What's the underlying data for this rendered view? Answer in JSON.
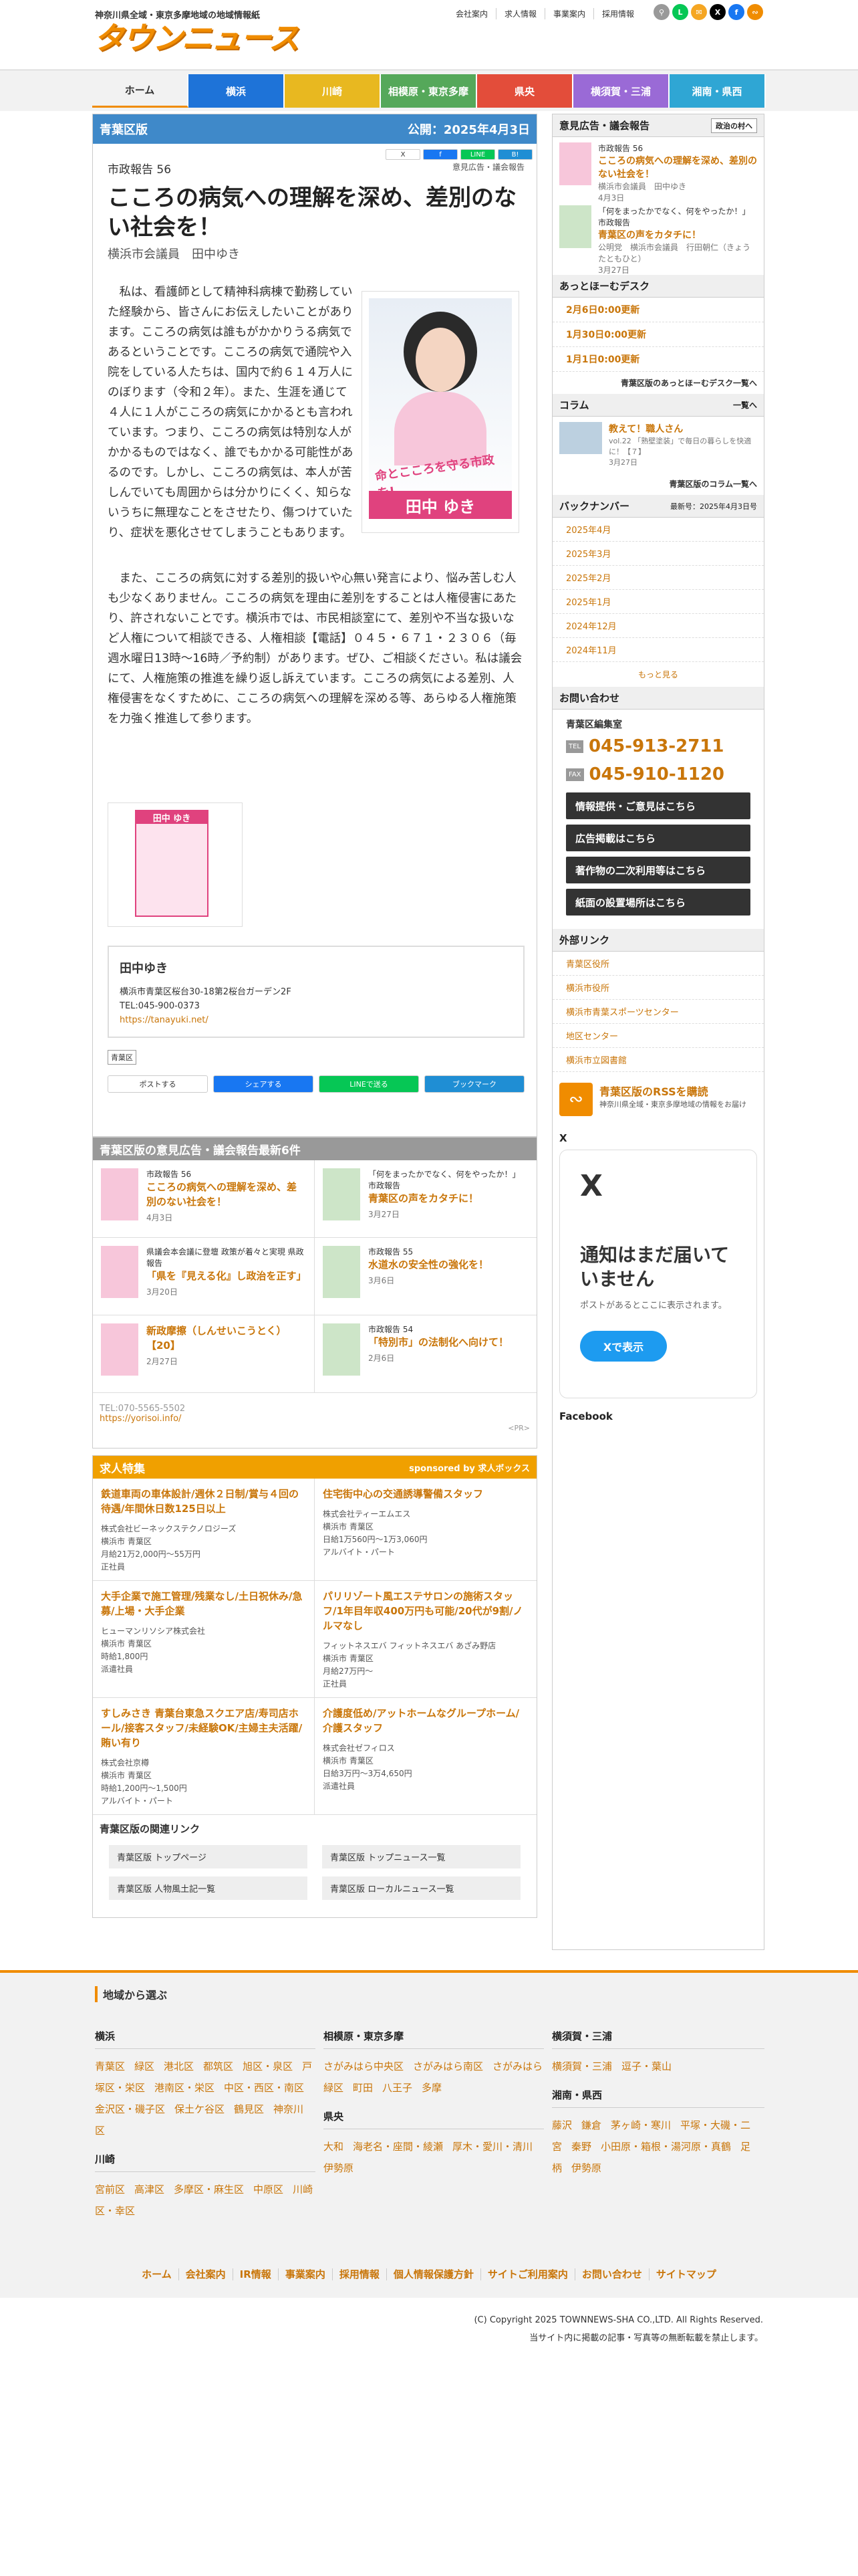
{
  "header": {
    "tagline": "神奈川県全域・東京多摩地域の地域情報紙",
    "logo": "タウンニュース",
    "links": [
      "会社案内",
      "求人情報",
      "事業案内",
      "採用情報"
    ]
  },
  "nav": [
    {
      "label": "ホーム",
      "color": "#f2f2f2",
      "text": "#333"
    },
    {
      "label": "横浜",
      "color": "#1e73d8",
      "text": "#fff"
    },
    {
      "label": "川崎",
      "color": "#e8b820",
      "text": "#fff"
    },
    {
      "label": "相模原・東京多摩",
      "color": "#55a85a",
      "text": "#fff"
    },
    {
      "label": "県央",
      "color": "#e34d3a",
      "text": "#fff"
    },
    {
      "label": "横須賀・三浦",
      "color": "#9a6ad6",
      "text": "#fff"
    },
    {
      "label": "湘南・県西",
      "color": "#2fa6d4",
      "text": "#fff"
    }
  ],
  "main": {
    "edition": "青葉区版",
    "published": "公開：2025年4月3日",
    "share_mini": [
      "X",
      "f",
      "LINE",
      "B!"
    ],
    "category": "市政報告 56",
    "category2": "意見広告・議会報告",
    "title": "こころの病気への理解を深め、差別のない社会を！",
    "byline": "横浜市会議員　田中ゆき",
    "photo_caption1": "命とこころを守る",
    "photo_caption2": "市政を!",
    "photo_name": "田中 ゆき",
    "p1": "私は、看護師として精神科病棟で勤務していた経験から、皆さんにお伝えしたいことがあります。こころの病気は誰もがかかりうる病気であるということです。こころの病気で通院や入院をしている人たちは、国内で約６１４万人にのぼります（令和２年）。また、生涯を通じて４人に１人がこころの病気にかかるとも言われています。つまり、こころの病気は特別な人がかかるものではなく、誰でもかかる可能性があるのです。しかし、こころの病気は、本人が苦しんでいても周囲からは分かりにくく、知らないうちに無理なことをさせたり、傷つけていたり、症状を悪化させてしまうこともあります。",
    "p2": "また、こころの病気に対する差別的扱いや心無い発言により、悩み苦しむ人も少なくありません。こころの病気を理由に差別をすることは人権侵害にあたり、許されないことです。横浜市では、市民相談室にて、差別や不当な扱いなど人権について相談できる、人権相談【電話】０４５・６７１・２３０６（毎週水曜日13時〜16時／予約制）があります。ぜひ、ご相談ください。私は議会にて、人権施策の推進を繰り返し訴えています。こころの病気による差別、人権侵害をなくすために、こころの病気への理解を深める等、あらゆる人権施策を力強く推進して参ります。",
    "ad_name": "田中 ゆき",
    "contact": {
      "name": "田中ゆき",
      "addr": "横浜市青葉区桜台30-18第2桜台ガーデン2F",
      "tel": "TEL:045-900-0373",
      "url": "https://tanayuki.net/"
    },
    "tag": "青葉区",
    "share": [
      {
        "label": "ポストする",
        "bg": "#fff",
        "c": "#333"
      },
      {
        "label": "シェアする",
        "bg": "#1877f2",
        "c": "#fff"
      },
      {
        "label": "LINEで送る",
        "bg": "#06c755",
        "c": "#fff"
      },
      {
        "label": "ブックマーク",
        "bg": "#1f8ed4",
        "c": "#fff"
      }
    ],
    "latest_head": "青葉区版の意見広告・議会報告最新6件",
    "latest": [
      {
        "cat": "市政報告 56",
        "title": "こころの病気への理解を深め、差別のない社会を！",
        "date": "4月3日"
      },
      {
        "cat": "「何をまったかでなく、何をやったか！」 市政報告",
        "title": "青葉区の声をカタチに！",
        "date": "3月27日"
      },
      {
        "cat": "県議会本会議に登壇 政策が着々と実現 県政報告",
        "title": "「県を『見える化』し政治を正す」",
        "date": "3月20日"
      },
      {
        "cat": "市政報告 55",
        "title": "水道水の安全性の強化を！",
        "date": "3月6日"
      },
      {
        "cat": "",
        "title": "新政摩擦（しんせいこうとく）【20】",
        "date": "2月27日"
      },
      {
        "cat": "市政報告 54",
        "title": "「特別市」の法制化へ向けて！",
        "date": "2月6日"
      }
    ],
    "footer_tel": "TEL:070-5565-5502",
    "footer_url": "https://yorisoi.info/",
    "pr": "<PR>",
    "jobs_head": "求人特集",
    "jobs_sponsor": "sponsored by 求人ボックス",
    "jobs": [
      {
        "t": "鉄道車両の車体設計/週休２日制/賞与４回の待遇/年間休日数125日以上",
        "co": "株式会社ビーネックステクノロジーズ",
        "loc": "横浜市 青葉区",
        "pay": "月給21万2,000円〜55万円",
        "type": "正社員"
      },
      {
        "t": "住宅街中心の交通誘導警備スタッフ",
        "co": "株式会社ティーエムエス",
        "loc": "横浜市 青葉区",
        "pay": "日給1万560円〜1万3,060円",
        "type": "アルバイト・パート"
      },
      {
        "t": "大手企業で施工管理/残業なし/土日祝休み/急募/上場・大手企業",
        "co": "ヒューマンリソシア株式会社",
        "loc": "横浜市 青葉区",
        "pay": "時給1,800円",
        "type": "派遣社員"
      },
      {
        "t": "パリリゾート風エステサロンの施術スタッフ/1年目年収400万円も可能/20代が9割/ノルマなし",
        "co": "フィットネスエバ フィットネスエバ あざみ野店",
        "loc": "横浜市 青葉区",
        "pay": "月給27万円〜",
        "type": "正社員"
      },
      {
        "t": "すしみさき 青葉台東急スクエア店/寿司店ホール/接客スタッフ/未経験OK/主婦主夫活躍/賄い有り",
        "co": "株式会社京樽",
        "loc": "横浜市 青葉区",
        "pay": "時給1,200円〜1,500円",
        "type": "アルバイト・パート"
      },
      {
        "t": "介護度低め/アットホームなグループホーム/介護スタッフ",
        "co": "株式会社ゼフィロス",
        "loc": "横浜市 青葉区",
        "pay": "日給3万円〜3万4,650円",
        "type": "派遣社員"
      }
    ],
    "related_head": "青葉区版の関連リンク",
    "related": [
      "青葉区版 トップページ",
      "青葉区版 トップニュース一覧",
      "青葉区版 人物風土記一覧",
      "青葉区版 ローカルニュース一覧"
    ]
  },
  "side": {
    "ads_head": "意見広告・議会報告",
    "ads_btn": "政治の村へ",
    "ads": [
      {
        "cat": "市政報告 56",
        "title": "こころの病気への理解を深め、差別のない社会を！",
        "sub": "横浜市会議員　田中ゆき",
        "date": "4月3日"
      },
      {
        "cat": "「何をまったかでなく、何をやったか！」 市政報告",
        "title": "青葉区の声をカタチに！",
        "sub": "公明党　横浜市会議員　行田朝仁（きょうたともひと）",
        "date": "3月27日"
      }
    ],
    "desk_head": "あっとほーむデスク",
    "desk": [
      "2月6日0:00更新",
      "1月30日0:00更新",
      "1月1日0:00更新"
    ],
    "desk_more": "青葉区版のあっとほーむデスク一覧へ",
    "col_head": "コラム",
    "col_more": "一覧へ",
    "col": {
      "title": "教えて！職人さん",
      "sub": "vol.22 「熟壁塗装」で毎日の暮らしを快適に！【７】",
      "date": "3月27日"
    },
    "col_link": "青葉区版のコラム一覧へ",
    "bn_head": "バックナンバー",
    "bn_upd": "最新号：2025年4月3日号",
    "bn": [
      "2025年4月",
      "2025年3月",
      "2025年2月",
      "2025年1月",
      "2024年12月",
      "2024年11月"
    ],
    "bn_more": "もっと見る",
    "contact_head": "お問い合わせ",
    "contact_sub": "青葉区編集室",
    "tel": "045-913-2711",
    "fax": "045-910-1120",
    "btns": [
      "情報提供・ご意見はこちら",
      "広告掲載はこちら",
      "著作物の二次利用等はこちら",
      "紙面の設置場所はこちら"
    ],
    "ext_head": "外部リンク",
    "ext": [
      "青葉区役所",
      "横浜市役所",
      "横浜市青葉スポーツセンター",
      "地区センター",
      "横浜市立図書館"
    ],
    "rss_title": "青葉区版のRSSを購読",
    "rss_sub": "神奈川県全域・東京多摩地域の情報をお届け",
    "x_head": "X",
    "x_title": "通知はまだ届いていません",
    "x_sub": "ポストがあるとここに表示されます。",
    "x_btn": "Xで表示",
    "fb_head": "Facebook"
  },
  "footer": {
    "head": "地域から選ぶ",
    "yokohama": "横浜",
    "y_links": [
      "青葉区",
      "緑区",
      "港北区",
      "都筑区",
      "旭区・泉区",
      "戸塚区・栄区",
      "港南区・栄区",
      "中区・西区・南区",
      "金沢区・磯子区",
      "保土ケ谷区",
      "鶴見区",
      "神奈川区"
    ],
    "kawasaki": "川崎",
    "k_links": [
      "宮前区",
      "高津区",
      "多摩区・麻生区",
      "中原区",
      "川崎区・幸区"
    ],
    "sagami": "相模原・東京多摩",
    "s_links": [
      "さがみはら中央区",
      "さがみはら南区",
      "さがみはら緑区",
      "町田",
      "八王子",
      "多摩"
    ],
    "kenou": "県央",
    "ke_links": [
      "大和",
      "海老名・座間・綾瀬",
      "厚木・愛川・清川",
      "伊勢原"
    ],
    "yokosuka": "横須賀・三浦",
    "yo_links": [
      "横須賀・三浦",
      "逗子・葉山"
    ],
    "shonan": "湘南・県西",
    "sh_links": [
      "藤沢",
      "鎌倉",
      "茅ヶ崎・寒川",
      "平塚・大磯・二宮",
      "秦野",
      "小田原・箱根・湯河原・真鶴",
      "足柄",
      "伊勢原"
    ],
    "bar": [
      "ホーム",
      "会社案内",
      "IR情報",
      "事業案内",
      "採用情報",
      "個人情報保護方針",
      "サイトご利用案内",
      "お問い合わせ",
      "サイトマップ"
    ],
    "copy1": "(C) Copyright 2025 TOWNNEWS-SHA CO.,LTD. All Rights Reserved.",
    "copy2": "当サイト内に掲載の記事・写真等の無断転載を禁止します。"
  }
}
